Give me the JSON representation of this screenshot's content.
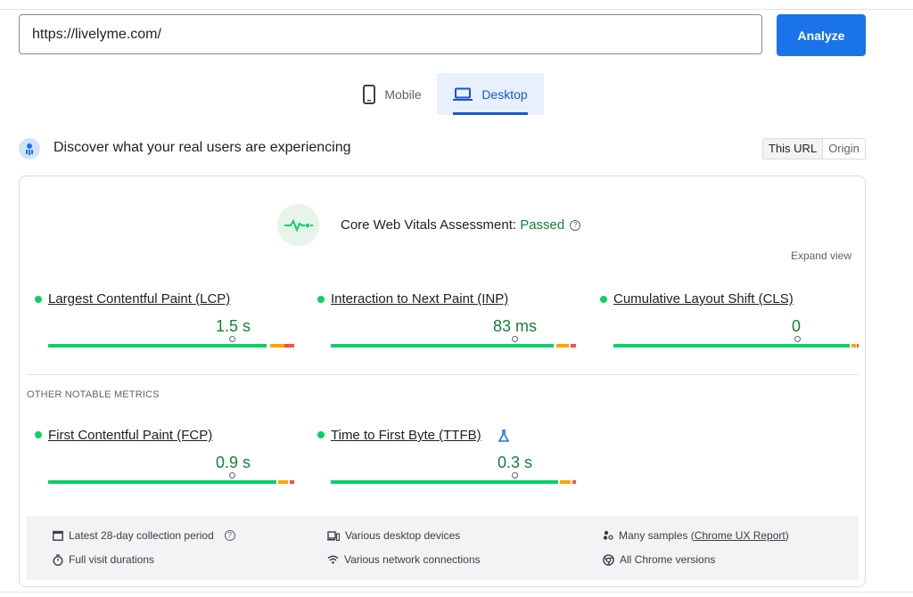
{
  "url_bar": {
    "value": "https://livelyme.com/",
    "analyze_label": "Analyze"
  },
  "device_tabs": [
    {
      "label": "Mobile"
    },
    {
      "label": "Desktop"
    }
  ],
  "crux": {
    "title": "Discover what your real users are experiencing",
    "toggle": [
      "This URL",
      "Origin"
    ],
    "assessment_prefix": "Core Web Vitals Assessment: ",
    "assessment_status": "Passed",
    "expand_label": "Expand view",
    "core_metrics": [
      {
        "name": "Largest Contentful Paint (LCP)",
        "value": "1.5 s"
      },
      {
        "name": "Interaction to Next Paint (INP)",
        "value": "83 ms"
      },
      {
        "name": "Cumulative Layout Shift (CLS)",
        "value": "0"
      }
    ],
    "other_label": "OTHER NOTABLE METRICS",
    "other_metrics": [
      {
        "name": "First Contentful Paint (FCP)",
        "value": "0.9 s"
      },
      {
        "name": "Time to First Byte (TTFB)",
        "value": "0.3 s"
      }
    ],
    "footer": {
      "period": "Latest 28-day collection period",
      "durations": "Full visit durations",
      "devices": "Various desktop devices",
      "connections": "Various network connections",
      "samples_prefix": "Many samples (",
      "samples_link": "Chrome UX Report",
      "samples_suffix": ")",
      "versions": "All Chrome versions"
    }
  },
  "colors": {
    "accent": "#1a73e8",
    "good": "#0cce6b",
    "needs_improvement": "#ffa400",
    "poor": "#ff4e42",
    "passed_text": "#188038"
  }
}
